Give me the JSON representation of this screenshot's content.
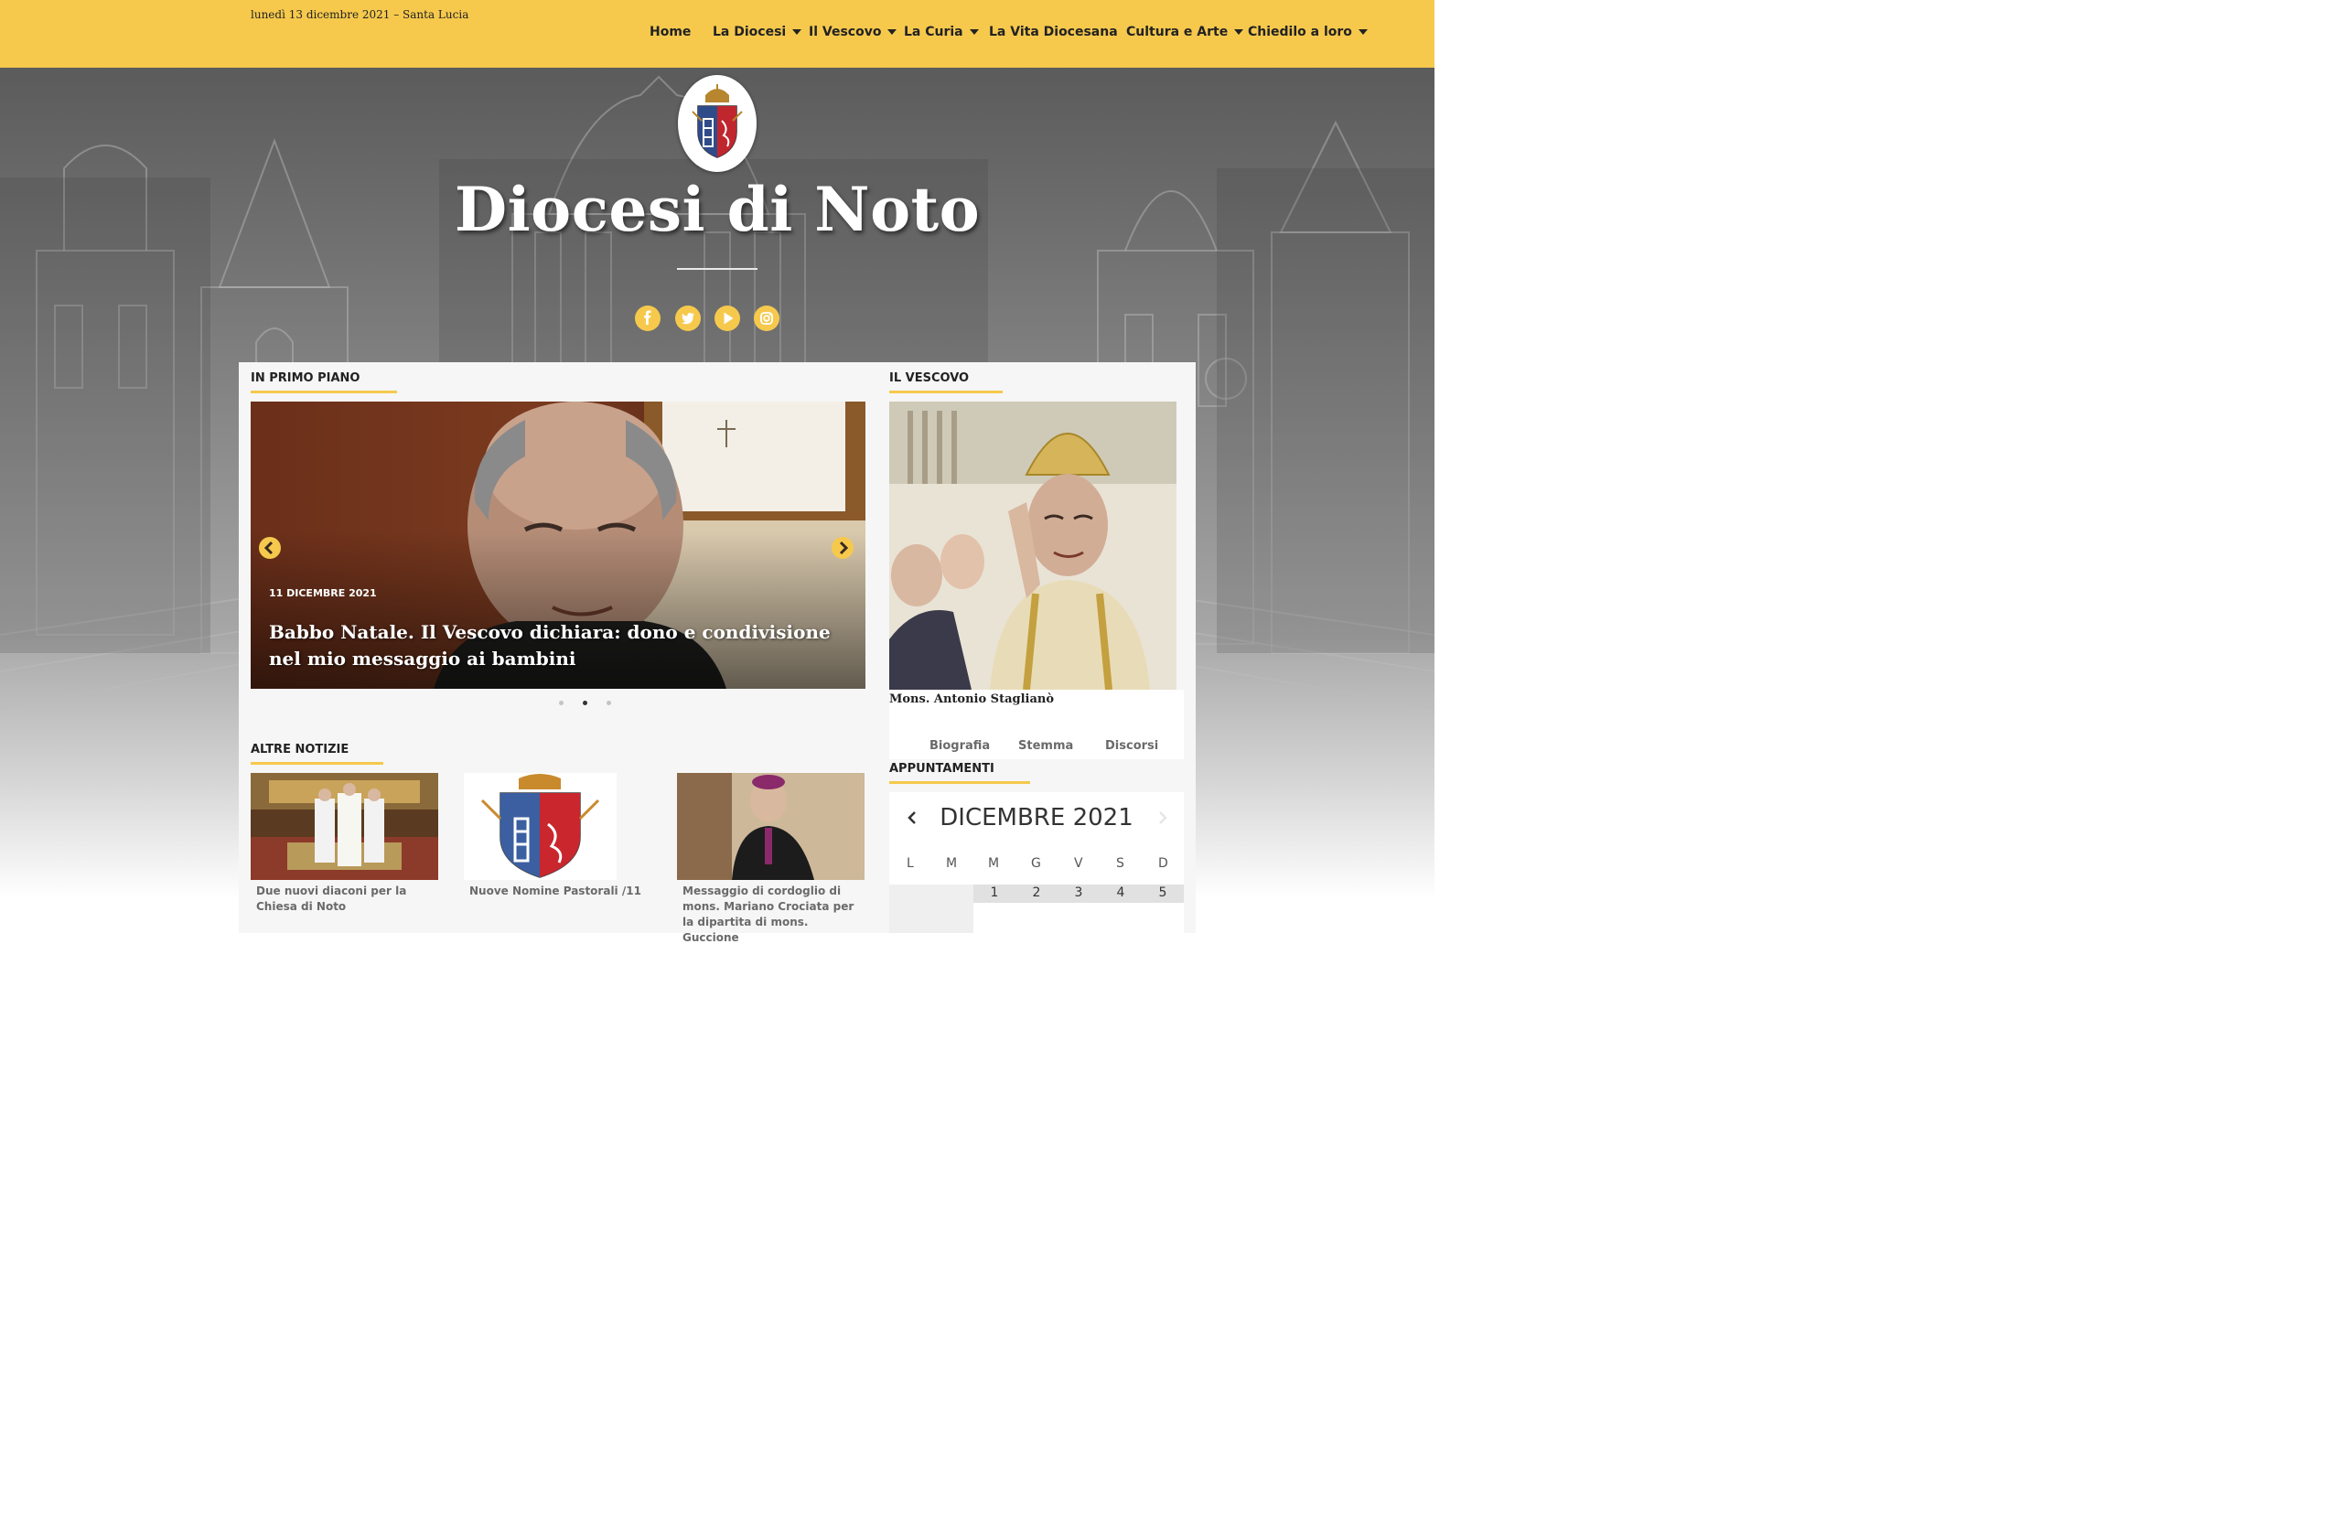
{
  "topbar": {
    "date": "lunedì 13 dicembre 2021 – Santa Lucia",
    "nav": [
      {
        "label": "Home",
        "caret": false
      },
      {
        "label": "La Diocesi",
        "caret": true
      },
      {
        "label": "Il Vescovo",
        "caret": true
      },
      {
        "label": "La Curia",
        "caret": true
      },
      {
        "label": "La Vita Diocesana",
        "caret": false
      },
      {
        "label": "Cultura e Arte",
        "caret": true
      },
      {
        "label": "Chiedilo a loro",
        "caret": true
      }
    ]
  },
  "hero": {
    "title": "Diocesi di Noto",
    "social": [
      "facebook-icon",
      "twitter-icon",
      "youtube-icon",
      "instagram-icon"
    ]
  },
  "primo_piano": {
    "heading": "IN PRIMO PIANO",
    "slide": {
      "date": "11 DICEMBRE 2021",
      "title": "Babbo Natale. Il Vescovo dichiara: dono e condivisione nel mio messaggio ai bambini"
    },
    "slide_count": 3,
    "active_slide": 2
  },
  "altre_notizie": {
    "heading": "ALTRE NOTIZIE",
    "items": [
      {
        "caption": "Due nuovi diaconi per la Chiesa di Noto"
      },
      {
        "caption": "Nuove Nomine Pastorali /11"
      },
      {
        "caption": "Messaggio di cordoglio di mons. Mariano Crociata per la dipartita di mons. Guccione"
      }
    ]
  },
  "vescovo": {
    "heading": "IL VESCOVO",
    "name": "Mons. Antonio Staglianò",
    "links": [
      "Biografia",
      "Stemma",
      "Discorsi"
    ]
  },
  "appuntamenti": {
    "heading": "APPUNTAMENTI",
    "month": "DICEMBRE 2021",
    "weekdays": [
      "L",
      "M",
      "M",
      "G",
      "V",
      "S",
      "D"
    ],
    "days": [
      "1",
      "2",
      "3",
      "4",
      "5"
    ]
  },
  "colors": {
    "accent": "#f6c94d",
    "text_dark": "#222222",
    "text_muted": "#6a6a6a",
    "panel_bg": "#f6f6f6"
  }
}
